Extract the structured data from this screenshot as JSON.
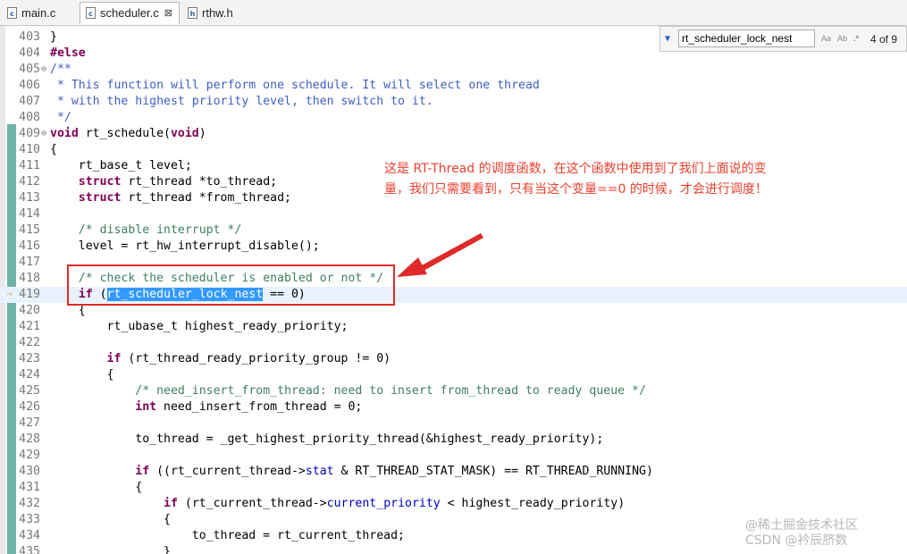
{
  "tabs": [
    {
      "label": "main.c",
      "icon": "c-file-icon"
    },
    {
      "label": "scheduler.c",
      "icon": "c-file-icon"
    },
    {
      "label": "rthw.h",
      "icon": "h-file-icon"
    }
  ],
  "tab_close_glyph": "⊠",
  "find_bar": {
    "query": "rt_scheduler_lock_nest",
    "match_case_label": "Aa",
    "whole_word_label": "Ab",
    "regex_label": ".*",
    "count": "4 of 9"
  },
  "code_lines": [
    {
      "n": "403",
      "text": "}"
    },
    {
      "n": "404",
      "text": "#else"
    },
    {
      "n": "405",
      "text": "/**"
    },
    {
      "n": "406",
      "text": " * This function will perform one schedule. It will select one thread"
    },
    {
      "n": "407",
      "text": " * with the highest priority level, then switch to it."
    },
    {
      "n": "408",
      "text": " */"
    },
    {
      "n": "409",
      "text": "void rt_schedule(void)"
    },
    {
      "n": "410",
      "text": "{"
    },
    {
      "n": "411",
      "text": "    rt_base_t level;"
    },
    {
      "n": "412",
      "text": "    struct rt_thread *to_thread;"
    },
    {
      "n": "413",
      "text": "    struct rt_thread *from_thread;"
    },
    {
      "n": "414",
      "text": ""
    },
    {
      "n": "415",
      "text": "    /* disable interrupt */"
    },
    {
      "n": "416",
      "text": "    level = rt_hw_interrupt_disable();"
    },
    {
      "n": "417",
      "text": ""
    },
    {
      "n": "418",
      "text": "    /* check the scheduler is enabled or not */"
    },
    {
      "n": "419",
      "text": "    if (rt_scheduler_lock_nest == 0)"
    },
    {
      "n": "420",
      "text": "    {"
    },
    {
      "n": "421",
      "text": "        rt_ubase_t highest_ready_priority;"
    },
    {
      "n": "422",
      "text": ""
    },
    {
      "n": "423",
      "text": "        if (rt_thread_ready_priority_group != 0)"
    },
    {
      "n": "424",
      "text": "        {"
    },
    {
      "n": "425",
      "text": "            /* need_insert_from_thread: need to insert from_thread to ready queue */"
    },
    {
      "n": "426",
      "text": "            int need_insert_from_thread = 0;"
    },
    {
      "n": "427",
      "text": ""
    },
    {
      "n": "428",
      "text": "            to_thread = _get_highest_priority_thread(&highest_ready_priority);"
    },
    {
      "n": "429",
      "text": ""
    },
    {
      "n": "430",
      "text": "            if ((rt_current_thread->stat & RT_THREAD_STAT_MASK) == RT_THREAD_RUNNING)"
    },
    {
      "n": "431",
      "text": "            {"
    },
    {
      "n": "432",
      "text": "                if (rt_current_thread->current_priority < highest_ready_priority)"
    },
    {
      "n": "433",
      "text": "                {"
    },
    {
      "n": "434",
      "text": "                    to_thread = rt_current_thread;"
    },
    {
      "n": "435",
      "text": "                }"
    }
  ],
  "annotation": "这是 RT-Thread 的调度函数，在这个函数中使用到了我们上面说的变量，我们只需要看到，只有当这个变量==0 的时候，才会进行调度！",
  "watermark": {
    "line1": "@稀土掘金技术社区",
    "line2": "CSDN @衿辰脐数"
  },
  "colors": {
    "keyword": "#7f0055",
    "comment": "#3f7f5f",
    "javadoc": "#3f5fbf",
    "member": "#0000c0",
    "selection": "#3399ff",
    "annotation": "#e8412f",
    "highlight_box": "#e02a2a"
  }
}
